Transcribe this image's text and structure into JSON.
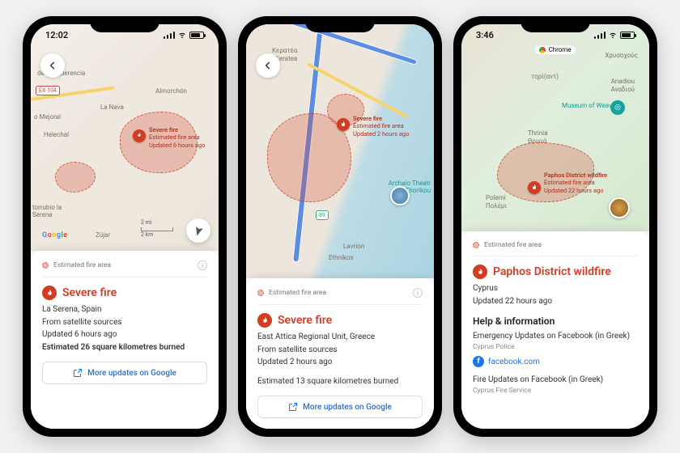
{
  "phones": [
    {
      "status_time": "12:02",
      "map": {
        "back_icon": "arrow-left",
        "places": {
          "benquerencia": "de Benquerencia",
          "mejoral": "o Mejoral",
          "helechal": "Helechal",
          "lanava": "La Nava",
          "almorchon": "Almorchón",
          "serena": "torrubio la Serena",
          "zujar": "Zújar",
          "route": "EX-104"
        },
        "fire_label_title": "Severe fire",
        "fire_label_sub1": "Estimated fire area",
        "fire_label_sub2": "Updated 6 hours ago",
        "scale_top": "2 mi",
        "scale_bottom": "2 km",
        "logo": "Google"
      },
      "estimate_label": "Estimated fire area",
      "card_title": "Severe fire",
      "line1": "La Serena, Spain",
      "line2": "From satellite sources",
      "line3": "Updated 6 hours ago",
      "line4": "Estimated 26 square kilometres burned",
      "updates_btn": "More updates on Google"
    },
    {
      "status_time": "",
      "map": {
        "places": {
          "keratea": "Κερατέα",
          "keratea_en": "Keratea",
          "lavrion": "Lavrion",
          "ethnikos": "Ethnikos",
          "archaio": "Archaio Theatr",
          "thorikou": "Thorikou",
          "route": "89"
        },
        "fire_label_title": "Severe fire",
        "fire_label_sub1": "Estimated fire area",
        "fire_label_sub2": "Updated 2 hours ago"
      },
      "estimate_label": "Estimated fire area",
      "card_title": "Severe fire",
      "line1": "East Attica Regional Unit, Greece",
      "line2": "From satellite sources",
      "line3": "Updated 2 hours ago",
      "line5": "Estimated 13 square kilometres burned",
      "updates_btn": "More updates on Google"
    },
    {
      "status_time": "3:46",
      "status_app": "Chrome",
      "map": {
        "places": {
          "thrinia": "Thrinia",
          "thrinia_gr": "Θρινιά",
          "polemi": "Polemi",
          "polemi_gr": "Πολέμι",
          "anadiou": "Anadiou",
          "anadiou_gr": "Αναδιού",
          "chrysochous": "Χρυσοχούς",
          "tirgandt": "τηρί(αντ)",
          "museum": "Museum of Weaving"
        },
        "fire_label_title": "Paphos District wildfire",
        "fire_label_sub1": "Estimated fire area",
        "fire_label_sub2": "Updated 22 hours ago"
      },
      "estimate_label": "Estimated fire area",
      "card_title": "Paphos District wildfire",
      "line1": "Cyprus",
      "line3": "Updated 22 hours ago",
      "help_head": "Help & information",
      "help_item1": "Emergency Updates on Facebook (in Greek)",
      "help_src1": "Cyprus Police",
      "fb_label": "facebook.com",
      "help_item2": "Fire Updates on Facebook (in Greek)",
      "help_src2": "Cyprus Fire Service"
    }
  ]
}
